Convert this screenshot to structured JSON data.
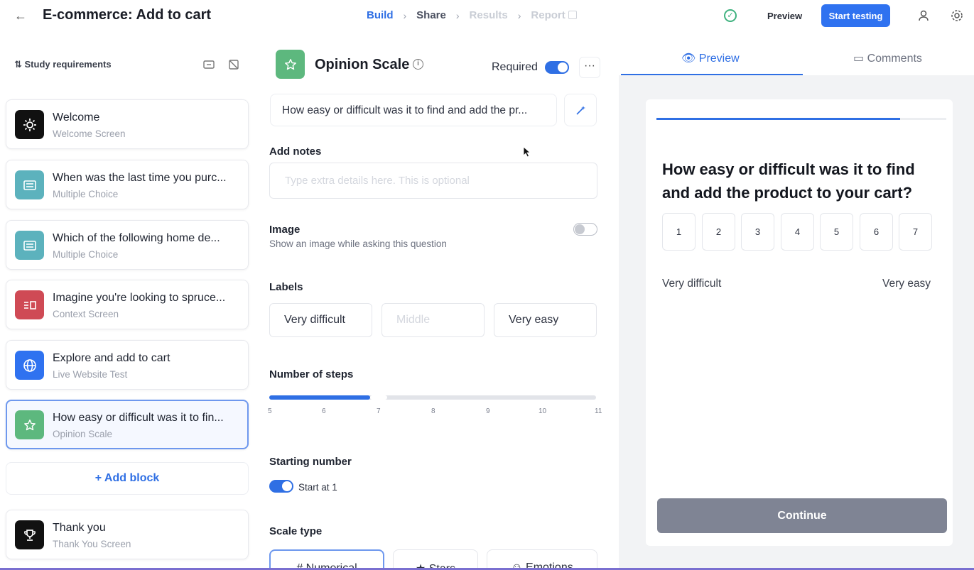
{
  "header": {
    "title": "E-commerce: Add to cart",
    "steps": [
      {
        "label": "Build"
      },
      {
        "label": "Share"
      },
      {
        "label": "Results"
      },
      {
        "label": "Report"
      }
    ],
    "preview_label": "Preview",
    "start_label": "Start testing"
  },
  "sidebar": {
    "study_requirements": "Study requirements",
    "blocks": [
      {
        "title": "Welcome",
        "subtitle": "Welcome Screen",
        "icon": "gear-icon",
        "color": "#111111"
      },
      {
        "title": "When was the last time you purc...",
        "subtitle": "Multiple Choice",
        "icon": "list-icon",
        "color": "#5cb2bd"
      },
      {
        "title": "Which of the following home de...",
        "subtitle": "Multiple Choice",
        "icon": "list-icon",
        "color": "#5cb2bd"
      },
      {
        "title": "Imagine you're looking to spruce...",
        "subtitle": "Context Screen",
        "icon": "context-icon",
        "color": "#cf4a55"
      },
      {
        "title": "Explore and add to cart",
        "subtitle": "Live Website Test",
        "icon": "globe-icon",
        "color": "#2f72f0"
      },
      {
        "title": "How easy or difficult was it to fin...",
        "subtitle": "Opinion Scale",
        "icon": "star-icon",
        "color": "#5db87e"
      }
    ],
    "add_block": "Add block",
    "thank_you": {
      "title": "Thank you",
      "subtitle": "Thank You Screen",
      "icon": "trophy-icon",
      "color": "#111111"
    }
  },
  "editor": {
    "block_type": "Opinion Scale",
    "required_label": "Required",
    "required_on": true,
    "question": "How easy or difficult was it to find and add the pr...",
    "add_notes_label": "Add notes",
    "notes_placeholder": "Type extra details here. This is optional",
    "image_label": "Image",
    "image_desc": "Show an image while asking this question",
    "image_on": false,
    "labels_heading": "Labels",
    "labels": {
      "left": "Very difficult",
      "middle_placeholder": "Middle",
      "right": "Very easy"
    },
    "steps_heading": "Number of steps",
    "step_ticks": [
      "5",
      "6",
      "7",
      "8",
      "9",
      "10",
      "11"
    ],
    "steps_value": 7,
    "starting_heading": "Starting number",
    "start_at_label": "Start at 1",
    "start_at_on": true,
    "scale_type_heading": "Scale type",
    "scale_types": [
      "Numerical",
      "Stars",
      "Emotions"
    ],
    "scale_type_selected": "Numerical"
  },
  "preview": {
    "tabs": [
      "Preview",
      "Comments"
    ],
    "progress": 0.84,
    "question": "How easy or difficult was it to find and add the product to your cart?",
    "scale": [
      "1",
      "2",
      "3",
      "4",
      "5",
      "6",
      "7"
    ],
    "left_label": "Very difficult",
    "right_label": "Very easy",
    "continue_label": "Continue"
  },
  "colors": {
    "accent": "#2f6fe4",
    "continue_bg": "#7f8494"
  }
}
